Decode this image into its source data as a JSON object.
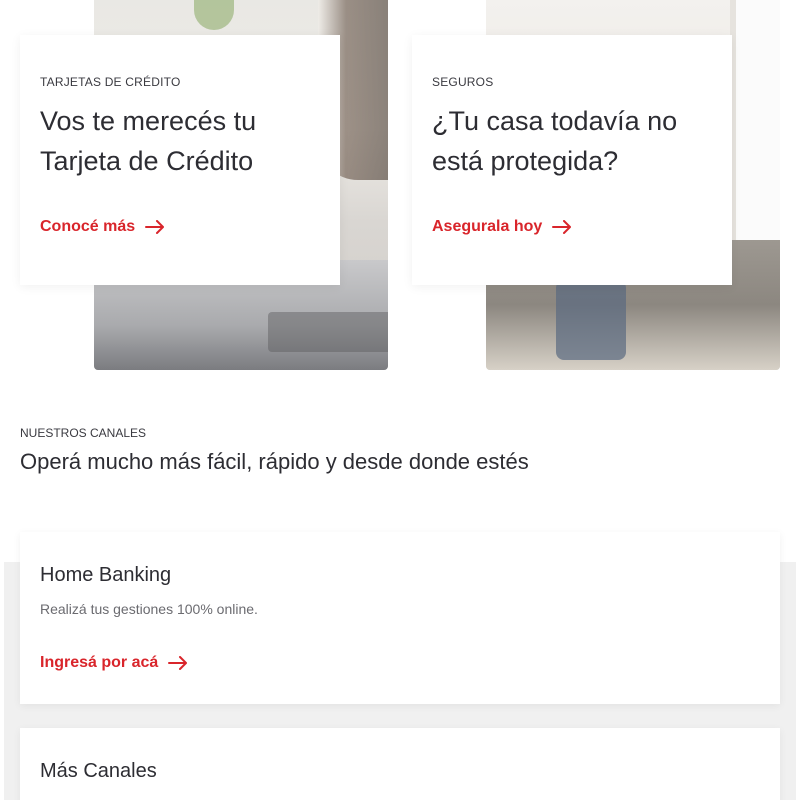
{
  "promos": [
    {
      "eyebrow": "TARJETAS DE CRÉDITO",
      "title": "Vos te merecés tu Tarjeta de Crédito",
      "cta": "Conocé más"
    },
    {
      "eyebrow": "SEGUROS",
      "title": "¿Tu casa todavía no está protegida?",
      "cta": "Asegurala hoy"
    }
  ],
  "channels_section": {
    "eyebrow": "NUESTROS CANALES",
    "title": "Operá mucho más fácil, rápido y desde donde estés"
  },
  "channels": [
    {
      "title": "Home Banking",
      "description": "Realizá tus gestiones 100% online.",
      "cta": "Ingresá por acá"
    },
    {
      "title": "Más Canales"
    }
  ],
  "colors": {
    "accent": "#d9252b",
    "text": "#2d2d33",
    "muted": "#6b6b70",
    "section_bg": "#f0f0f0"
  },
  "icons": {
    "cta_arrow": "arrow-right-icon"
  }
}
